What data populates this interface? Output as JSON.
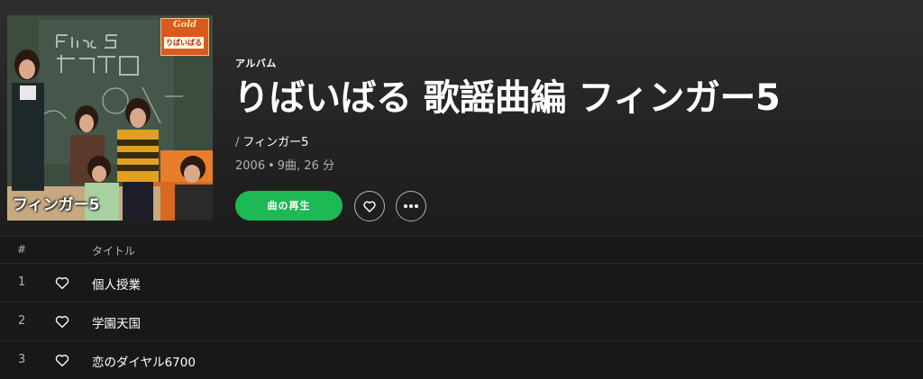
{
  "album": {
    "type_label": "アルバム",
    "title": "りばいばる 歌謡曲編 フィンガー5",
    "artist_prefix": "/",
    "artist": "フィンガー5",
    "year": "2006",
    "separator": "•",
    "track_summary": "9曲, 26 分",
    "cover": {
      "badge_title": "Gold",
      "badge_subtitle": "りばいばる",
      "artist_caption": "フィンガー5"
    }
  },
  "controls": {
    "play_label": "曲の再生",
    "like_icon": "heart-icon",
    "more_icon": "ellipsis-icon"
  },
  "tracklist": {
    "columns": {
      "number": "#",
      "title": "タイトル"
    },
    "tracks": [
      {
        "number": "1",
        "title": "個人授業"
      },
      {
        "number": "2",
        "title": "学園天国"
      },
      {
        "number": "3",
        "title": "恋のダイヤル6700"
      }
    ]
  },
  "colors": {
    "background": "#181818",
    "accent_green": "#1db954",
    "secondary_text": "#b3b3b3"
  }
}
